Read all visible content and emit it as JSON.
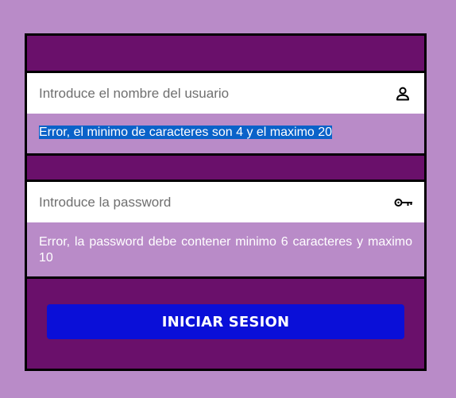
{
  "form": {
    "username": {
      "placeholder": "Introduce el nombre del usuario",
      "value": "",
      "icon": "user-icon",
      "error": "Error, el minimo de caracteres son 4 y el maximo 20"
    },
    "password": {
      "placeholder": "Introduce la password",
      "value": "",
      "icon": "key-icon",
      "error": "Error, la password debe contener minimo 6 caracteres y maximo 10"
    },
    "submit_label": "INICIAR SESION"
  },
  "colors": {
    "page_background": "#b98bc8",
    "panel_background": "#6a106b",
    "button_background": "#0a0fd8",
    "error_text": "#ffffff",
    "selection_highlight": "#0a62c9"
  }
}
